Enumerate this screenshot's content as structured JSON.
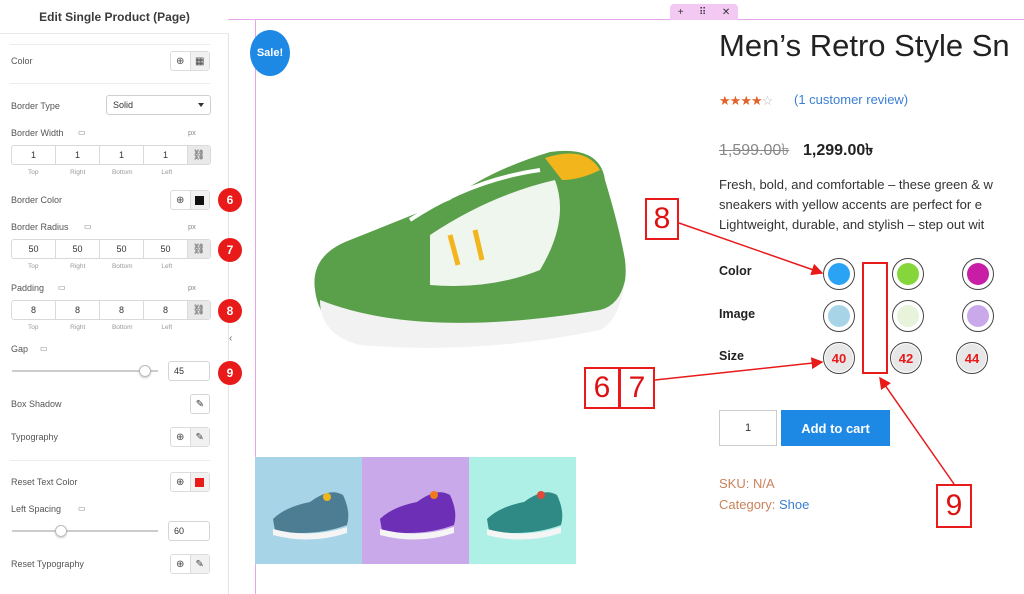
{
  "panel": {
    "title": "Edit Single Product (Page)",
    "color_label": "Color",
    "border_type_label": "Border Type",
    "border_type_value": "Solid",
    "border_width_label": "Border Width",
    "border_width_unit": "px",
    "border_width_values": [
      "1",
      "1",
      "1",
      "1"
    ],
    "dim_labels": [
      "Top",
      "Right",
      "Bottom",
      "Left"
    ],
    "border_color_label": "Border Color",
    "border_color_value": "#111111",
    "border_radius_label": "Border Radius",
    "border_radius_unit": "px",
    "border_radius_values": [
      "50",
      "50",
      "50",
      "50"
    ],
    "padding_label": "Padding",
    "padding_unit": "px",
    "padding_values": [
      "8",
      "8",
      "8",
      "8"
    ],
    "gap_label": "Gap",
    "gap_value": "45",
    "box_shadow_label": "Box Shadow",
    "typography_label": "Typography",
    "reset_text_color_label": "Reset Text Color",
    "reset_text_color_value": "#e81a1a",
    "left_spacing_label": "Left Spacing",
    "left_spacing_value": "60",
    "reset_typography_label": "Reset Typography"
  },
  "badges": [
    "6",
    "7",
    "8",
    "9"
  ],
  "product": {
    "sale_badge": "Sale!",
    "title": "Men’s Retro Style Sn",
    "rating": 4,
    "review_link": "(1 customer review)",
    "old_price": "1,599.00৳",
    "new_price": "1,299.00৳",
    "description": [
      "Fresh, bold, and comfortable – these green & w",
      "sneakers with yellow accents are perfect for e",
      "Lightweight, durable, and stylish – step out wit"
    ],
    "color_label": "Color",
    "image_label": "Image",
    "size_label": "Size",
    "colors": [
      "#2aa3f5",
      "#84d63a",
      "#c81ea6"
    ],
    "sizes": [
      "40",
      "42",
      "44"
    ],
    "qty": "1",
    "add_to_cart": "Add to cart",
    "sku_label": "SKU:",
    "sku_value": "N/A",
    "category_label": "Category:",
    "category_value": "Shoe",
    "thumb_colors": [
      "#a8d4e8",
      "#c9a9ea",
      "#aef0e6"
    ]
  },
  "annotations": {
    "label_8": "8",
    "label_6": "6",
    "label_7": "7",
    "label_9": "9"
  }
}
